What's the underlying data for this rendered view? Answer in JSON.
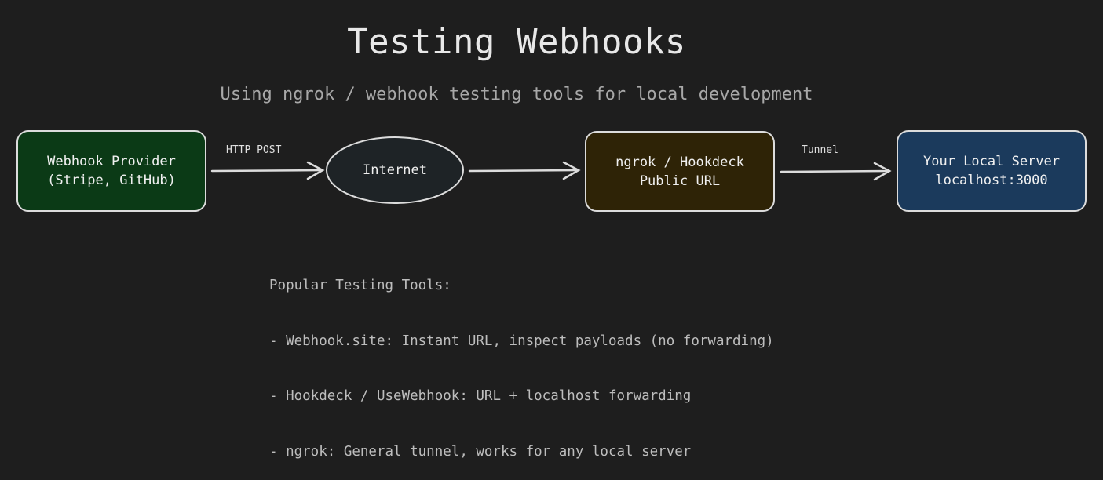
{
  "title": "Testing Webhooks",
  "subtitle": "Using ngrok / webhook testing tools for local development",
  "nodes": {
    "provider": {
      "line1": "Webhook Provider",
      "line2": "(Stripe, GitHub)",
      "fill": "#0b3a16"
    },
    "internet": {
      "line1": "Internet",
      "fill": "#1e2326"
    },
    "ngrok": {
      "line1": "ngrok / Hookdeck",
      "line2": "Public URL",
      "fill": "#2e2306"
    },
    "server": {
      "line1": "Your Local Server",
      "line2": "localhost:3000",
      "fill": "#1b3a5c"
    }
  },
  "edges": {
    "provider_to_internet": {
      "label": "HTTP POST"
    },
    "internet_to_ngrok": {
      "label": ""
    },
    "ngrok_to_server": {
      "label": "Tunnel"
    }
  },
  "notes": {
    "heading": "Popular Testing Tools:",
    "items": [
      "- Webhook.site: Instant URL, inspect payloads (no forwarding)",
      "- Hookdeck / UseWebhook: URL + localhost forwarding",
      "- ngrok: General tunnel, works for any local server"
    ]
  },
  "colors": {
    "background": "#1e1e1e",
    "stroke": "#dcdcdc"
  }
}
